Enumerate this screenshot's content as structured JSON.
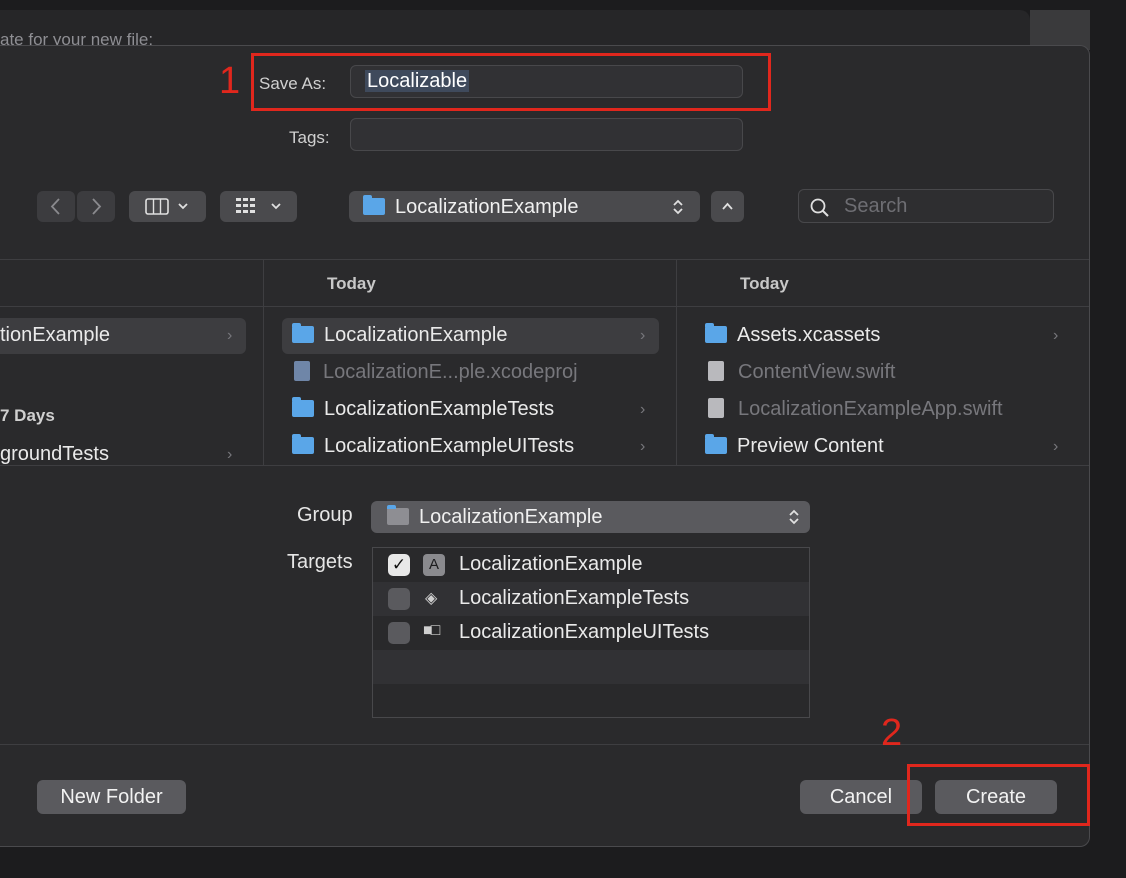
{
  "background_hint": "ate for your new file:",
  "save_as": {
    "label": "Save As:",
    "value": "Localizable"
  },
  "tags": {
    "label": "Tags:",
    "value": ""
  },
  "toolbar": {
    "back_icon": "chevron-left",
    "forward_icon": "chevron-right",
    "view_mode_icon": "column-view",
    "group_icon": "grid-view",
    "location": "LocalizationExample",
    "search_placeholder": "Search"
  },
  "columns": [
    {
      "header": "",
      "items": [
        {
          "label": "tionExample",
          "type": "selected",
          "chevron": true
        },
        {
          "label": "7 Days",
          "type": "section"
        },
        {
          "label": "groundTests",
          "type": "item",
          "chevron": true
        }
      ]
    },
    {
      "header": "Today",
      "items": [
        {
          "label": "LocalizationExample",
          "type": "folder",
          "selected": true,
          "chevron": true
        },
        {
          "label": "LocalizationE...ple.xcodeproj",
          "type": "file",
          "dim": true
        },
        {
          "label": "LocalizationExampleTests",
          "type": "folder",
          "chevron": true
        },
        {
          "label": "LocalizationExampleUITests",
          "type": "folder",
          "chevron": true
        }
      ]
    },
    {
      "header": "Today",
      "items": [
        {
          "label": "Assets.xcassets",
          "type": "folder",
          "chevron": true
        },
        {
          "label": "ContentView.swift",
          "type": "file",
          "dim": true
        },
        {
          "label": "LocalizationExampleApp.swift",
          "type": "file",
          "dim": true
        },
        {
          "label": "Preview Content",
          "type": "folder",
          "chevron": true
        }
      ]
    }
  ],
  "group": {
    "label": "Group",
    "value": "LocalizationExample"
  },
  "targets": {
    "label": "Targets",
    "items": [
      {
        "label": "LocalizationExample",
        "checked": true,
        "icon": "app-target-icon"
      },
      {
        "label": "LocalizationExampleTests",
        "checked": false,
        "icon": "unit-test-target-icon"
      },
      {
        "label": "LocalizationExampleUITests",
        "checked": false,
        "icon": "ui-test-target-icon"
      }
    ]
  },
  "buttons": {
    "new_folder": "New Folder",
    "cancel": "Cancel",
    "create": "Create"
  },
  "annotations": {
    "step1": "1",
    "step2": "2"
  },
  "colors": {
    "annotation_red": "#e0271d",
    "folder_blue": "#5aa6e8",
    "dialog_bg": "#2a2a2c"
  }
}
